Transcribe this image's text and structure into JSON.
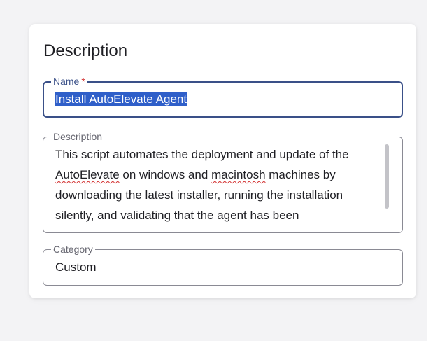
{
  "card": {
    "title": "Description"
  },
  "fields": {
    "name": {
      "label": "Name",
      "required_mark": "*",
      "value": "Install AutoElevate Agent"
    },
    "description": {
      "label": "Description",
      "value_parts": [
        "This script automates the deployment and update of the ",
        "AutoElevate",
        " on windows and ",
        "macintosh",
        " machines by downloading the latest installer, running the installation silently, and validating that the agent has been"
      ]
    },
    "category": {
      "label": "Category",
      "value": "Custom"
    }
  },
  "colors": {
    "focus_border": "#3a5088",
    "selection": "#2f5fc9",
    "required": "#d23030"
  }
}
